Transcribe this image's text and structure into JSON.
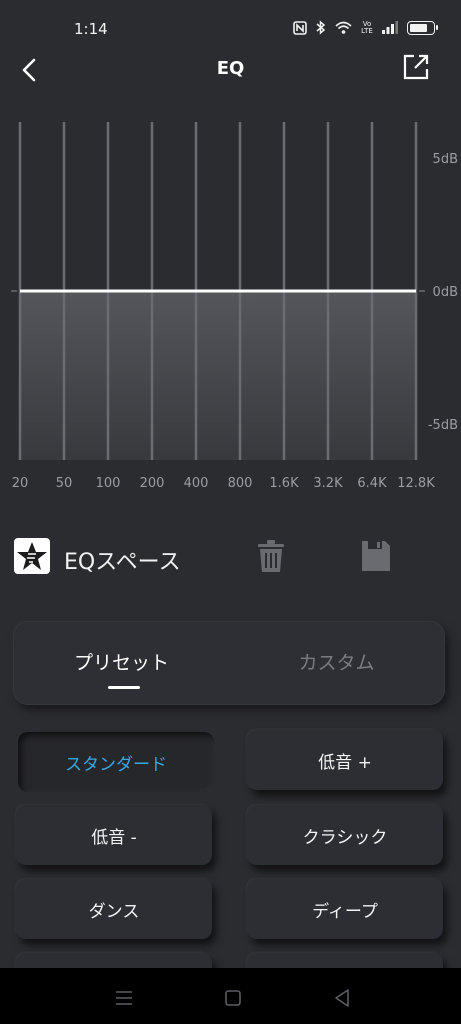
{
  "status_bar": {
    "time": "1:14",
    "network_label": "Vo LTE",
    "battery_level": 0.8
  },
  "header": {
    "title": "EQ"
  },
  "equalizer": {
    "db_labels": [
      "5dB",
      "0dB",
      "-5dB"
    ],
    "bands": [
      {
        "freq": "20",
        "gain_db": 0
      },
      {
        "freq": "50",
        "gain_db": 0
      },
      {
        "freq": "100",
        "gain_db": 0
      },
      {
        "freq": "200",
        "gain_db": 0
      },
      {
        "freq": "400",
        "gain_db": 0
      },
      {
        "freq": "800",
        "gain_db": 0
      },
      {
        "freq": "1.6K",
        "gain_db": 0
      },
      {
        "freq": "3.2K",
        "gain_db": 0
      },
      {
        "freq": "6.4K",
        "gain_db": 0
      },
      {
        "freq": "12.8K",
        "gain_db": 0
      }
    ],
    "db_range": [
      -7.5,
      7.5
    ]
  },
  "preset_bar": {
    "name": "EQスペース"
  },
  "tabs": {
    "preset": "プリセット",
    "custom": "カスタム"
  },
  "presets": [
    "スタンダード",
    "低音 +",
    "低音 -",
    "クラシック",
    "ダンス",
    "ディープ"
  ],
  "colors": {
    "accent": "#34a9e6",
    "background": "#2b2c30"
  }
}
